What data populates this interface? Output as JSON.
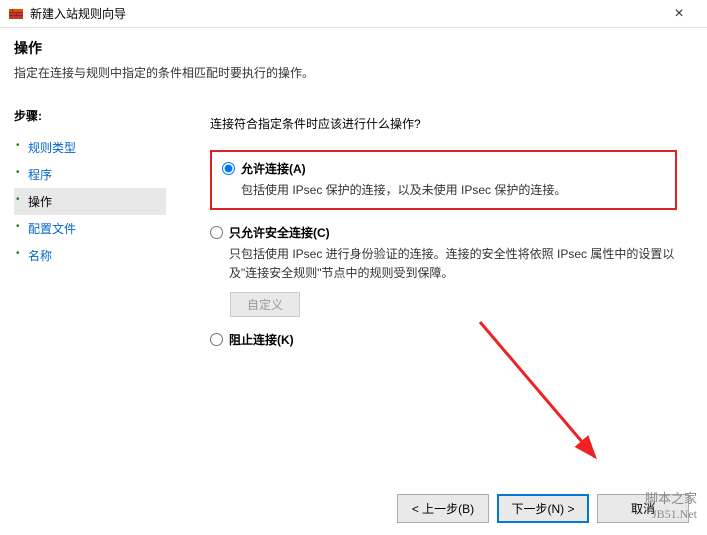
{
  "window": {
    "title": "新建入站规则向导",
    "close": "×"
  },
  "header": {
    "title": "操作",
    "subtitle": "指定在连接与规则中指定的条件相匹配时要执行的操作。"
  },
  "sidebar": {
    "steps_label": "步骤:",
    "items": [
      {
        "label": "规则类型",
        "active": false
      },
      {
        "label": "程序",
        "active": false
      },
      {
        "label": "操作",
        "active": true
      },
      {
        "label": "配置文件",
        "active": false
      },
      {
        "label": "名称",
        "active": false
      }
    ]
  },
  "main": {
    "question": "连接符合指定条件时应该进行什么操作?",
    "options": [
      {
        "id": "allow",
        "title": "允许连接(A)",
        "desc": "包括使用 IPsec 保护的连接，以及未使用 IPsec 保护的连接。",
        "checked": true,
        "highlighted": true
      },
      {
        "id": "secure",
        "title": "只允许安全连接(C)",
        "desc": "只包括使用 IPsec 进行身份验证的连接。连接的安全性将依照 IPsec 属性中的设置以及\"连接安全规则\"节点中的规则受到保障。",
        "checked": false,
        "highlighted": false
      },
      {
        "id": "block",
        "title": "阻止连接(K)",
        "desc": "",
        "checked": false,
        "highlighted": false
      }
    ],
    "custom_button": "自定义"
  },
  "footer": {
    "back": "< 上一步(B)",
    "next": "下一步(N) >",
    "cancel": "取消"
  },
  "watermark": {
    "line1": "脚本之家",
    "line2": "JB51.Net"
  }
}
